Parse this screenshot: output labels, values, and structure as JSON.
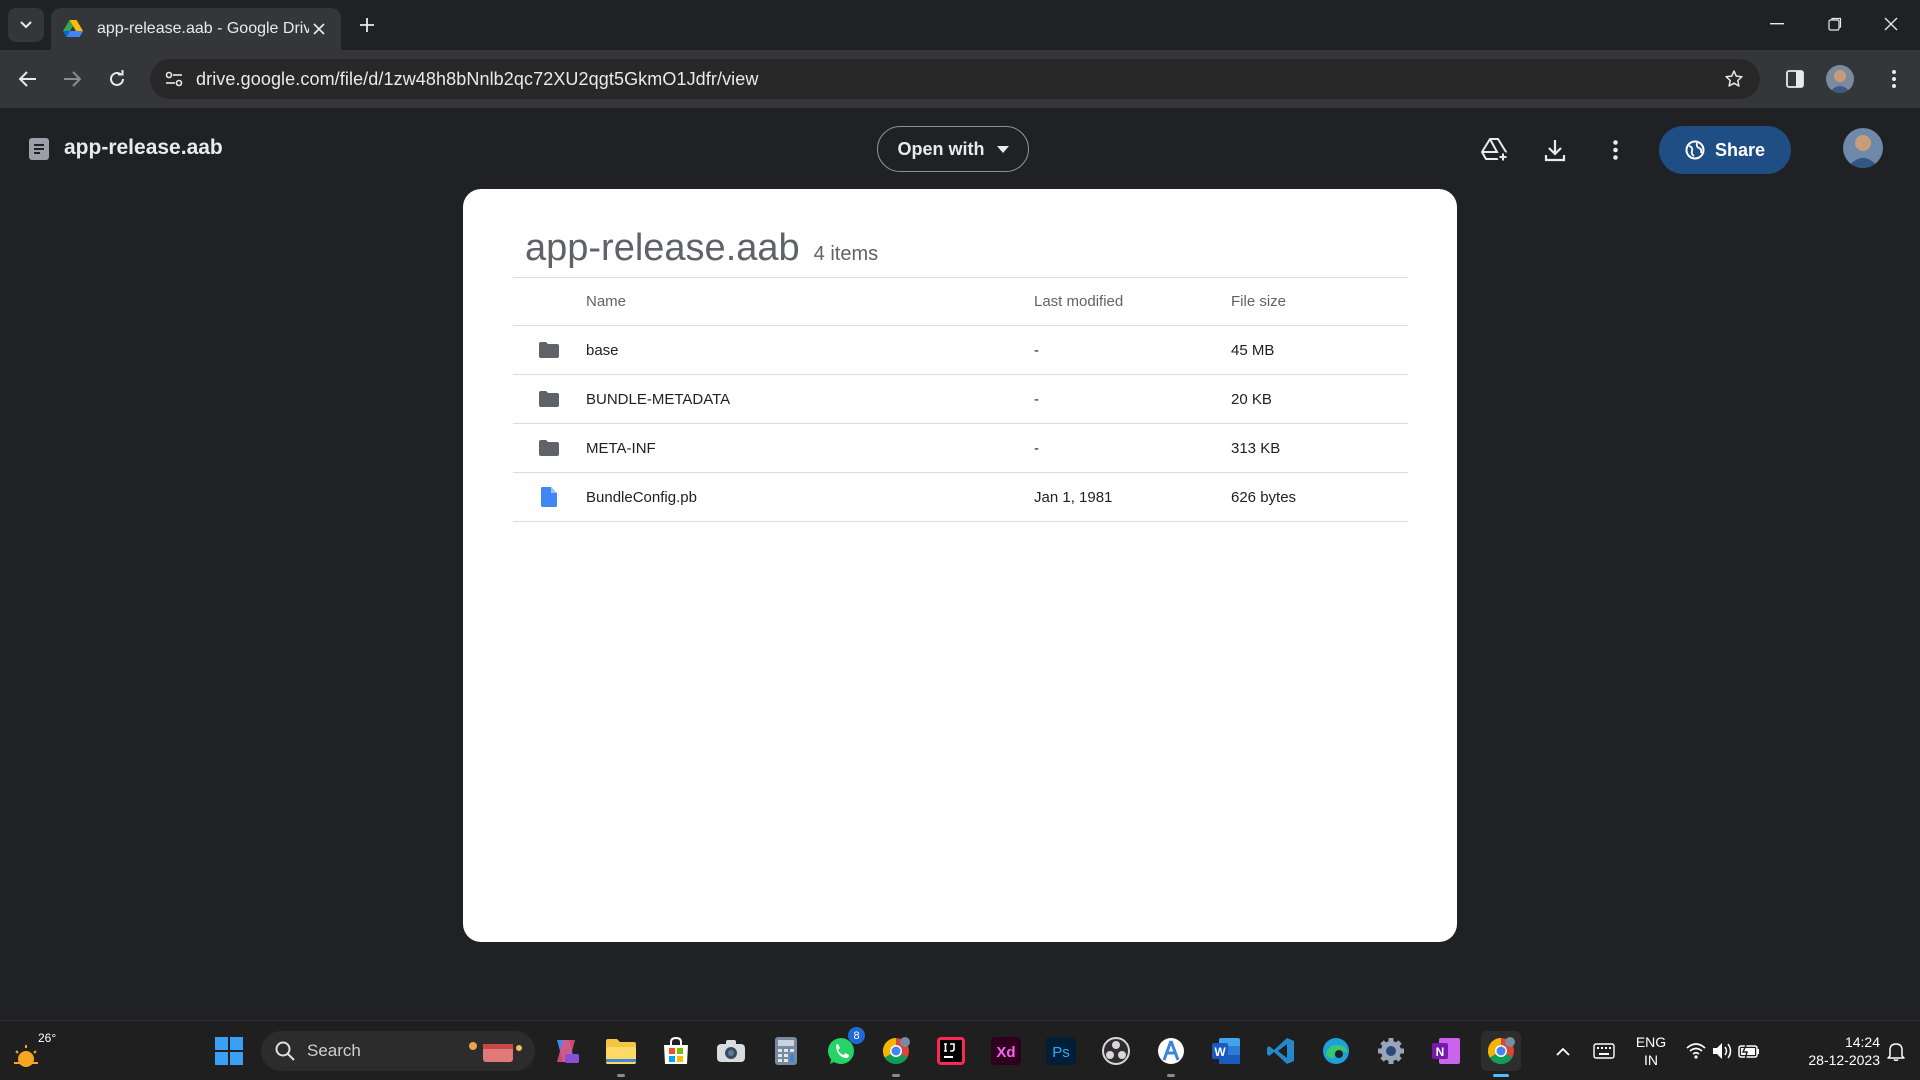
{
  "browser": {
    "tab": {
      "title": "app-release.aab - Google Drive",
      "favicon": "google-drive-icon"
    },
    "url": "drive.google.com/file/d/1zw48h8bNnlb2qc72XU2qgt5GkmO1Jdfr/view"
  },
  "viewer": {
    "file_name": "app-release.aab",
    "open_with_label": "Open with",
    "share_label": "Share"
  },
  "archive": {
    "title": "app-release.aab",
    "item_count": "4 items",
    "columns": {
      "name": "Name",
      "modified": "Last modified",
      "size": "File size"
    },
    "rows": [
      {
        "icon": "folder-icon",
        "name": "base",
        "modified": "-",
        "size": "45 MB"
      },
      {
        "icon": "folder-icon",
        "name": "BUNDLE-METADATA",
        "modified": "-",
        "size": "20 KB"
      },
      {
        "icon": "folder-icon",
        "name": "META-INF",
        "modified": "-",
        "size": "313 KB"
      },
      {
        "icon": "file-icon",
        "name": "BundleConfig.pb",
        "modified": "Jan 1, 1981",
        "size": "626 bytes"
      }
    ]
  },
  "taskbar": {
    "weather_temp": "26°",
    "search_label": "Search",
    "whatsapp_badge": "8",
    "lang_line1": "ENG",
    "lang_line2": "IN",
    "time": "14:24",
    "date": "28-12-2023"
  },
  "colors": {
    "share_button": "#1f4e85",
    "accent": "#4cc2ff",
    "folder": "#5f6368",
    "file": "#4285f4"
  }
}
